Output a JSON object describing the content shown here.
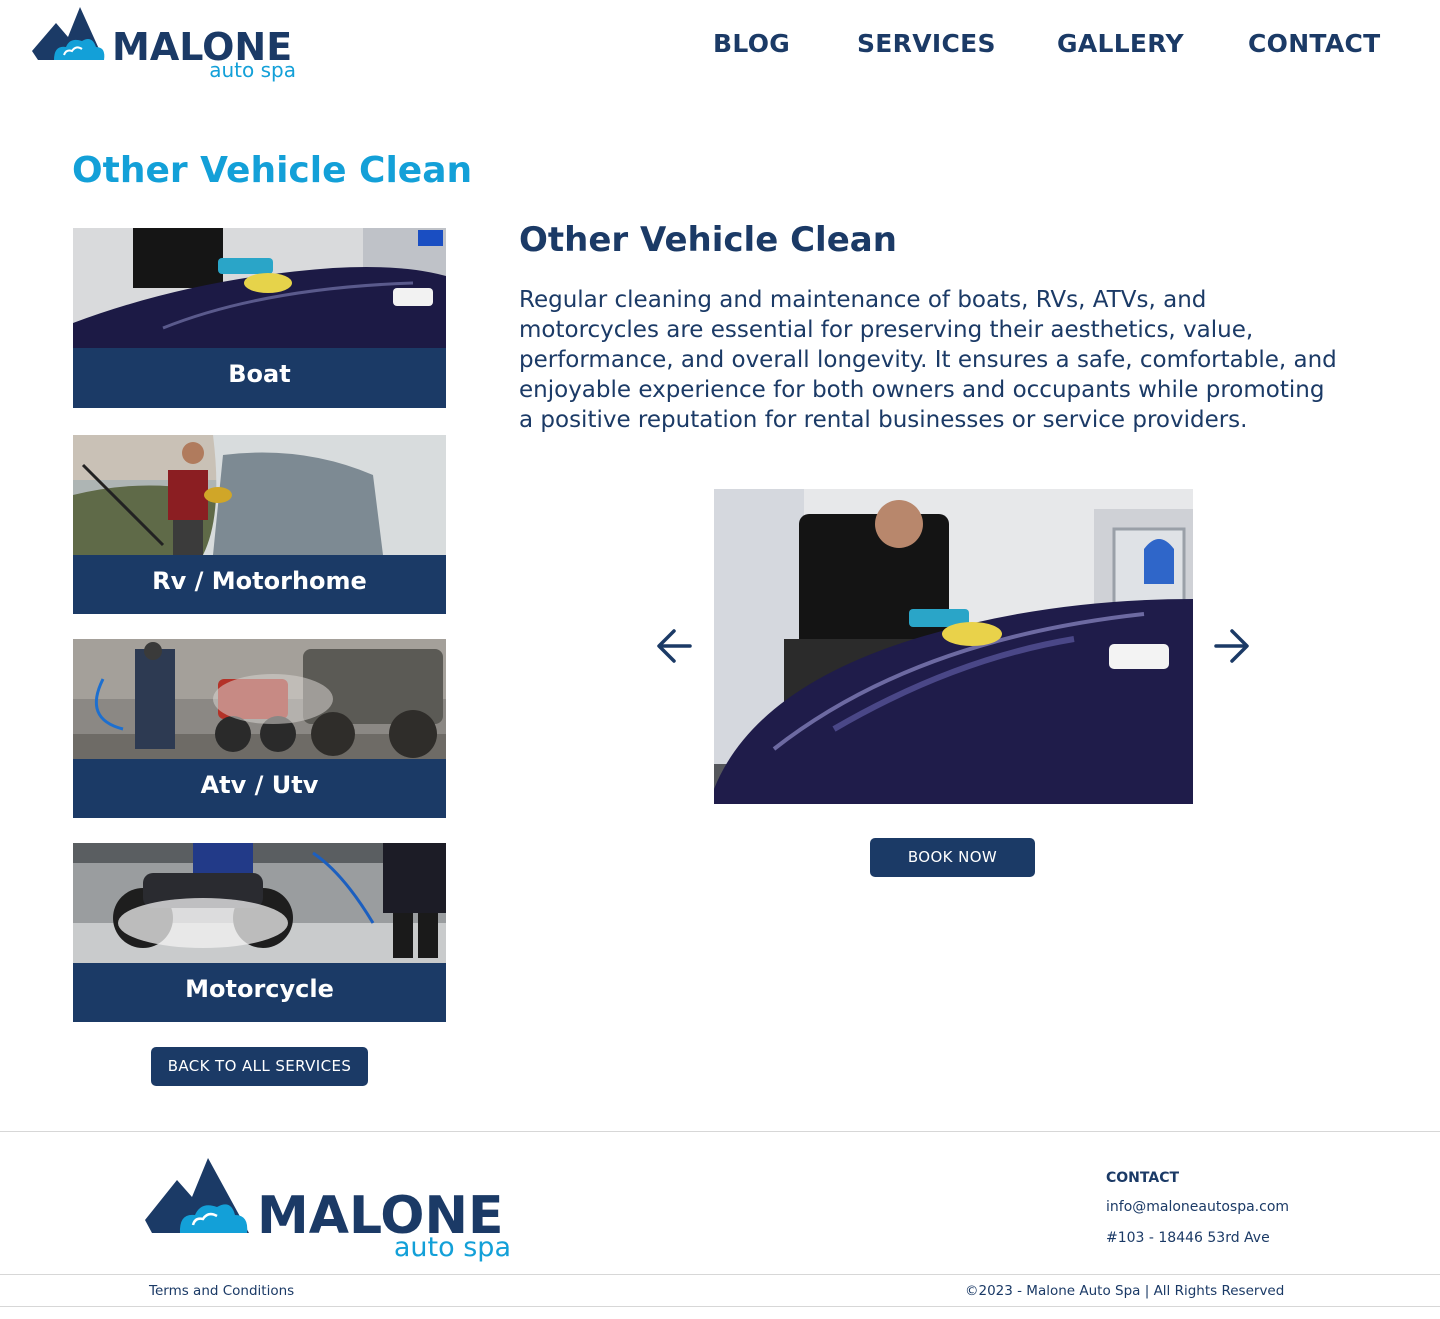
{
  "brand": {
    "name": "MALONE",
    "tagline": "auto spa",
    "colors": {
      "navy": "#1b3a66",
      "sky": "#13a0d8"
    }
  },
  "nav": {
    "items": [
      {
        "label": "BLOG"
      },
      {
        "label": "SERVICES"
      },
      {
        "label": "GALLERY"
      },
      {
        "label": "CONTACT"
      }
    ]
  },
  "page": {
    "title": "Other Vehicle Clean"
  },
  "services": {
    "cards": [
      {
        "label": "Boat"
      },
      {
        "label": "Rv / Motorhome"
      },
      {
        "label": "Atv / Utv"
      },
      {
        "label": "Motorcycle"
      }
    ],
    "back_label": "BACK TO ALL SERVICES"
  },
  "detail": {
    "title": "Other Vehicle Clean",
    "body": "Regular cleaning and maintenance of boats, RVs, ATVs, and motorcycles are essential for preserving their aesthetics, value, performance, and overall longevity. It ensures a safe, comfortable, and enjoyable experience for both owners and occupants while promoting a positive reputation for rental businesses or service providers.",
    "book_label": "BOOK NOW",
    "slider_icons": {
      "prev": "arrow-left-icon",
      "next": "arrow-right-icon"
    }
  },
  "footer": {
    "contact_heading": "CONTACT",
    "email": "info@maloneautospa.com",
    "address": "#103 - 18446 53rd Ave",
    "terms": "Terms and Conditions",
    "copyright": "©2023 - Malone Auto Spa  |   All Rights Reserved"
  }
}
